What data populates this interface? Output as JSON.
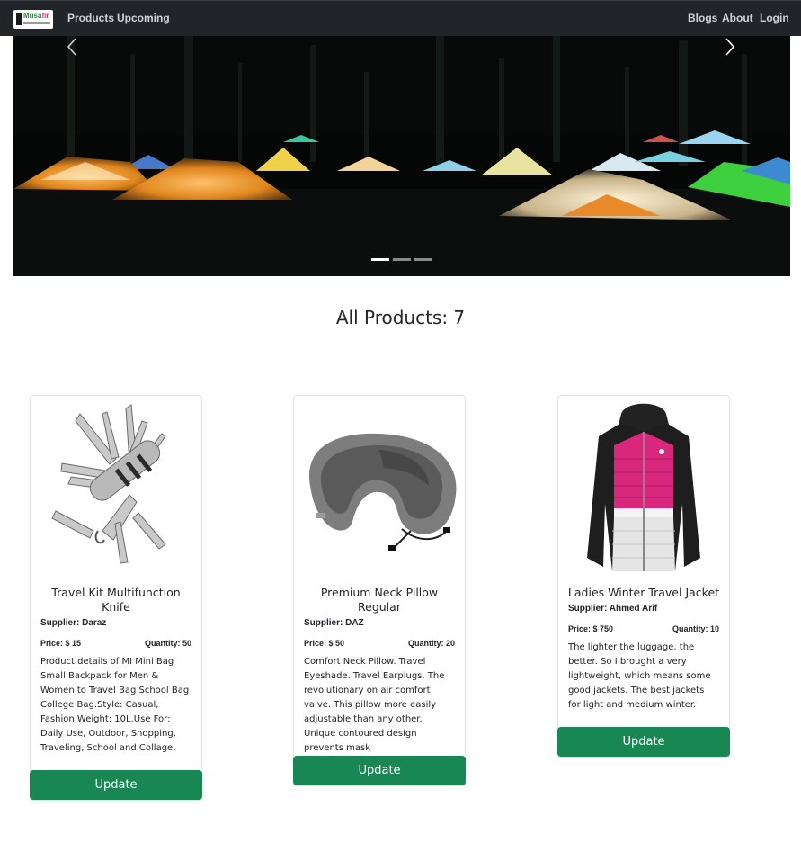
{
  "navbar": {
    "logo_text": "Musafir",
    "links_left": [
      "Products",
      "Upcoming"
    ],
    "links_right": [
      "Blogs",
      "About",
      "Login"
    ]
  },
  "carousel": {
    "slide_count": 3,
    "active_slide": 1,
    "prev_icon": "chevron-left-icon",
    "next_icon": "chevron-right-icon"
  },
  "heading": "All Products: 7",
  "products": [
    {
      "title": "Travel Kit Multifunction Knife",
      "supplier": "Supplier: Daraz",
      "price": "Price: $ 15",
      "quantity": "Quantity: 50",
      "description": "Product details of MI Mini Bag Small Backpack for Men & Women to Travel Bag School Bag College Bag.Style: Casual, Fashion.Weight: 10L.Use For: Daily Use, Outdoor, Shopping, Traveling, School and Collage.",
      "button": "Update"
    },
    {
      "title": "Premium Neck Pillow Regular",
      "supplier": "Supplier: DAZ",
      "price": "Price: $ 50",
      "quantity": "Quantity: 20",
      "description": "Comfort Neck Pillow. Travel Eyeshade. Travel Earplugs. The revolutionary on air comfort valve. This pillow more easily adjustable than any other. Unique contoured design prevents mask",
      "button": "Update"
    },
    {
      "title": "Ladies Winter Travel Jacket",
      "supplier": "Supplier: Ahmed Arif",
      "price": "Price: $ 750",
      "quantity": "Quantity: 10",
      "description": "The lighter the luggage, the better. So I brought a very lightweight, which means some good jackets. The best jackets for light and medium winter.",
      "button": "Update"
    }
  ],
  "colors": {
    "navbar": "#212529",
    "button": "#198754"
  }
}
